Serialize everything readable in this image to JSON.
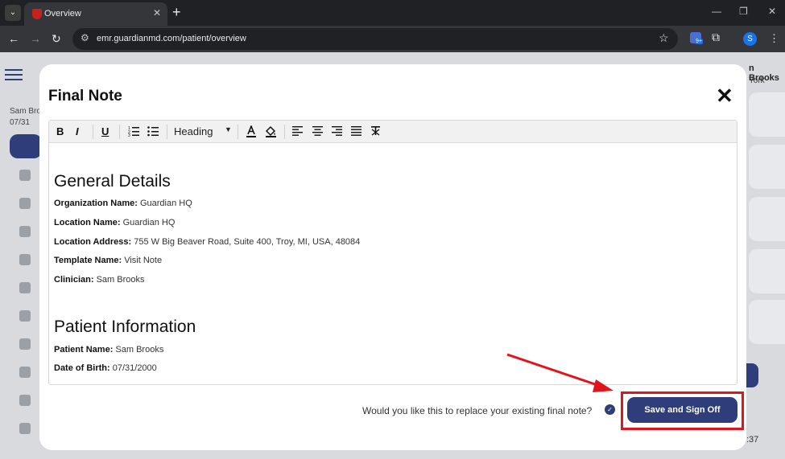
{
  "browser": {
    "tab_title": "Overview",
    "url": "emr.guardianmd.com/patient/overview",
    "profile_initial": "S",
    "extension_badge": "9+"
  },
  "background_app": {
    "sidebar_patient_name": "Sam Broo",
    "sidebar_patient_date": "07/31",
    "header_name": "n Brooks",
    "header_city": "York",
    "right_time": ":37"
  },
  "modal": {
    "title": "Final Note",
    "toolbar": {
      "bold": "B",
      "italic": "I",
      "underline": "U",
      "heading": "Heading"
    },
    "content": {
      "general_heading": "General Details",
      "general_fields": [
        {
          "label": "Organization Name:",
          "value": "Guardian HQ"
        },
        {
          "label": "Location Name:",
          "value": "Guardian HQ"
        },
        {
          "label": "Location Address:",
          "value": "755 W Big Beaver Road, Suite 400, Troy, MI, USA, 48084"
        },
        {
          "label": "Template Name:",
          "value": "Visit Note"
        },
        {
          "label": "Clinician:",
          "value": "Sam Brooks"
        }
      ],
      "patient_heading": "Patient Information",
      "patient_fields": [
        {
          "label": "Patient Name:",
          "value": "Sam Brooks"
        },
        {
          "label": "Date of Birth:",
          "value": "07/31/2000"
        }
      ]
    },
    "confirm_text": "Would you like this to replace your existing final note?",
    "save_button": "Save and Sign Off"
  },
  "colors": {
    "primary": "#2f3e7a",
    "highlight": "#e0151c"
  }
}
